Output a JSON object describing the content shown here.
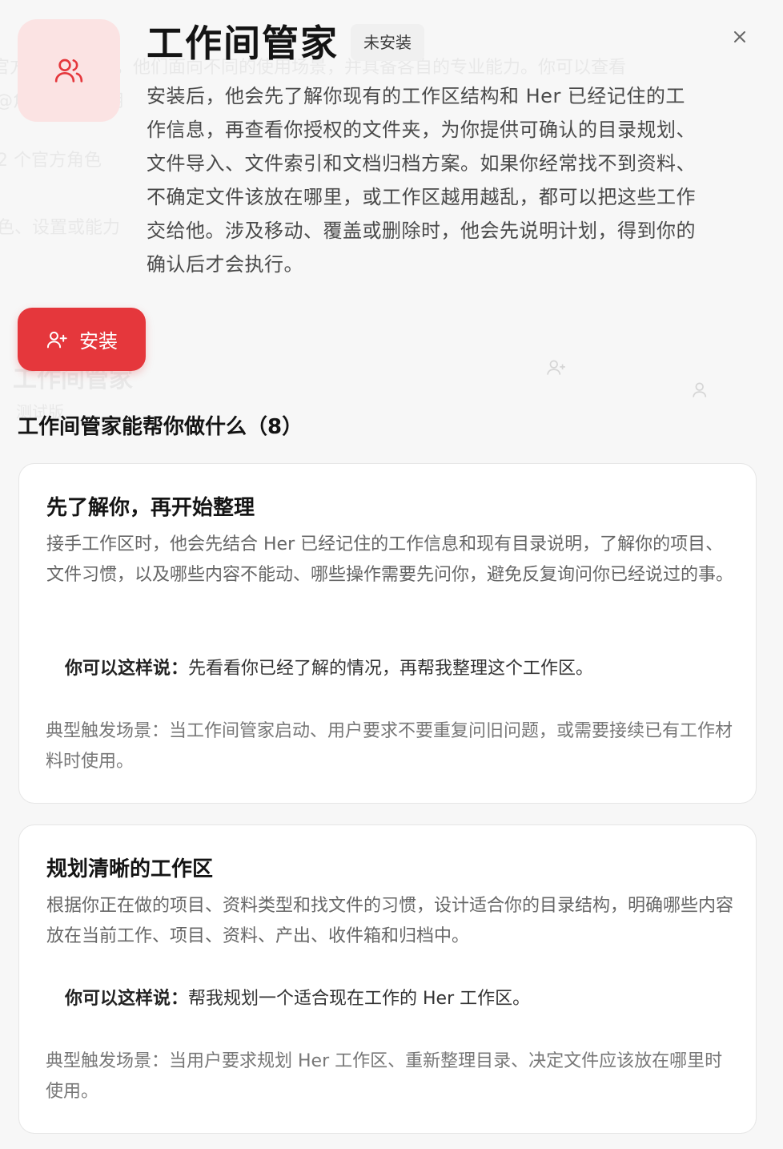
{
  "header": {
    "title": "工作间管家",
    "status": "未安装",
    "description": "安装后，他会先了解你现有的工作区结构和 Her 已经记住的工作信息，再查看你授权的文件夹，为你提供可确认的目录规划、文件导入、文件索引和文档归档方案。如果你经常找不到资料、不确定文件该放在哪里，或工作区越用越乱，都可以把这些工作交给他。涉及移动、覆盖或删除时，他会先说明计划，得到你的确认后才会执行。",
    "avatar_icon": "users-icon",
    "accent_color": "#e5373c",
    "avatar_bg": "#fbe3e3"
  },
  "actions": {
    "install_label": "安装",
    "install_icon": "user-plus-icon",
    "close_icon": "close-icon"
  },
  "section": {
    "title": "工作间管家能帮你做什么（8）"
  },
  "cards": [
    {
      "title": "先了解你，再开始整理",
      "description": "接手工作区时，他会先结合 Her 已经记住的工作信息和现有目录说明，了解你的项目、文件习惯，以及哪些内容不能动、哪些操作需要先问你，避免反复询问你已经说过的事。",
      "say_label": "你可以这样说：",
      "say_text": "先看看你已经了解的情况，再帮我整理这个工作区。",
      "trigger": "典型触发场景：当工作间管家启动、用户要求不要重复问旧问题，或需要接续已有工作材料时使用。"
    },
    {
      "title": "规划清晰的工作区",
      "description": "根据你正在做的项目、资料类型和找文件的习惯，设计适合你的目录结构，明确哪些内容放在当前工作、项目、资料、产出、收件箱和归档中。",
      "say_label": "你可以这样说：",
      "say_text": "帮我规划一个适合现在工作的 Her 工作区。",
      "trigger": "典型触发场景：当用户要求规划 Her 工作区、重新整理目录、决定文件应该放在哪里时使用。"
    }
  ],
  "background": {
    "line1": "官方设定的角色，他们面向不同的使用场景，并具备各自的专业能力。你可以查看",
    "line2": "@角色名称 使用",
    "line3": "2 个官方角色",
    "line4": "色、设置或能力",
    "line5": "工作间管家",
    "line6": "测试版"
  }
}
